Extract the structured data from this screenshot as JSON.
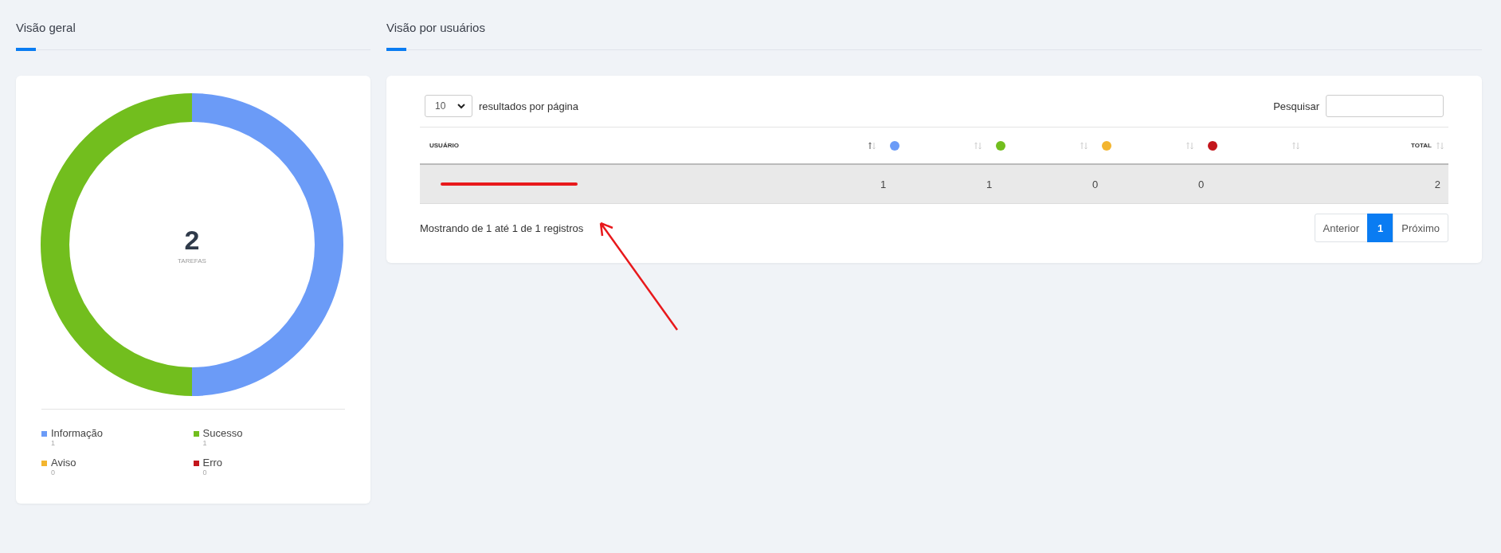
{
  "overview": {
    "title": "Visão geral",
    "center_value": "2",
    "center_label": "TAREFAS",
    "legend": [
      {
        "label": "Informação",
        "count": "1",
        "color": "#6b9bf7"
      },
      {
        "label": "Sucesso",
        "count": "1",
        "color": "#72be1e"
      },
      {
        "label": "Aviso",
        "count": "0",
        "color": "#f3b52f"
      },
      {
        "label": "Erro",
        "count": "0",
        "color": "#c3161c"
      }
    ]
  },
  "users": {
    "title": "Visão por usuários",
    "page_size": "10",
    "page_size_label": "resultados por página",
    "search_label": "Pesquisar",
    "columns": [
      {
        "kind": "text",
        "label": "USUÁRIO",
        "sorted": true
      },
      {
        "kind": "dot",
        "color": "#6b9bf7",
        "sorted": false
      },
      {
        "kind": "dot",
        "color": "#72be1e",
        "sorted": false
      },
      {
        "kind": "dot",
        "color": "#f3b52f",
        "sorted": false
      },
      {
        "kind": "dot",
        "color": "#c3161c",
        "sorted": false
      },
      {
        "kind": "total",
        "label": "TOTAL",
        "sorted": false
      }
    ],
    "rows": [
      {
        "redacted": true,
        "cells": [
          "1",
          "1",
          "0",
          "0",
          "2"
        ]
      }
    ],
    "info": "Mostrando de 1 até 1 de 1 registros",
    "pagination": [
      {
        "label": "Anterior",
        "selected": false
      },
      {
        "label": "1",
        "selected": true
      },
      {
        "label": "Próximo",
        "selected": false
      }
    ]
  }
}
